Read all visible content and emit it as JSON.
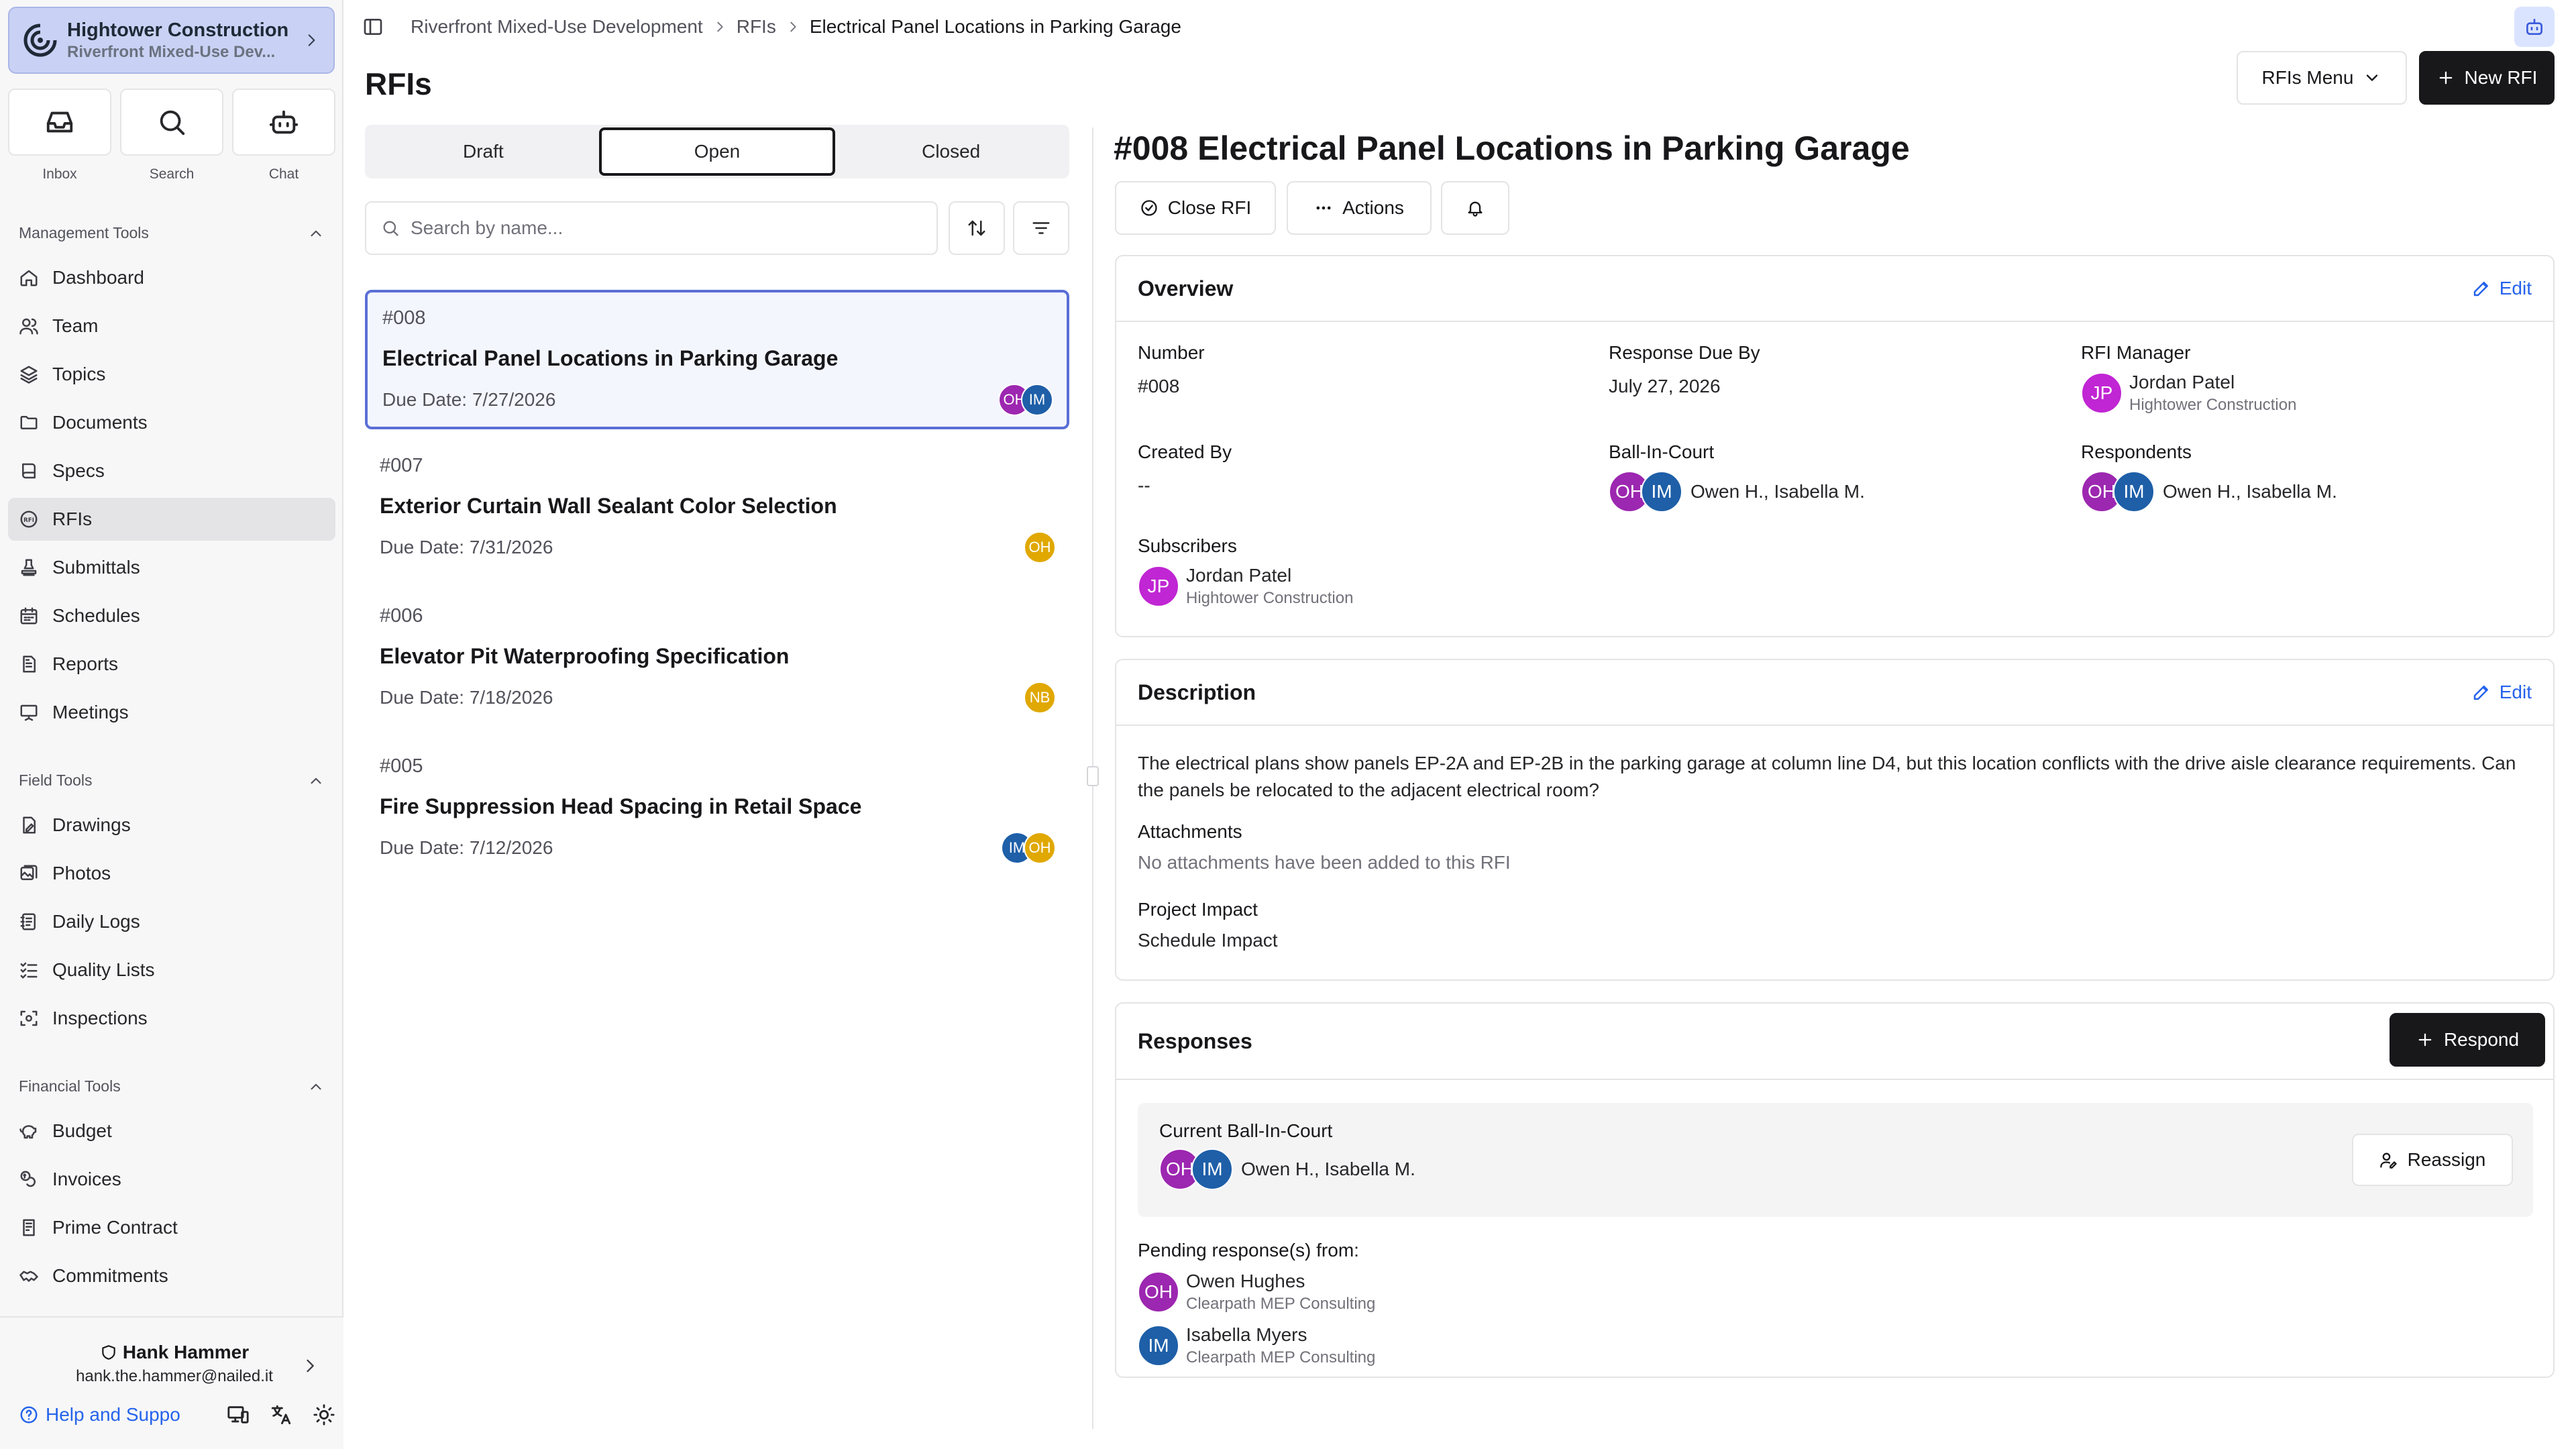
{
  "sidebar": {
    "project_name": "Hightower Construction",
    "project_sub": "Riverfront Mixed-Use Dev...",
    "quick": [
      {
        "label": "Inbox"
      },
      {
        "label": "Search"
      },
      {
        "label": "Chat"
      }
    ],
    "sections": {
      "management": "Management Tools",
      "field": "Field Tools",
      "financial": "Financial Tools"
    },
    "management_items": [
      "Dashboard",
      "Team",
      "Topics",
      "Documents",
      "Specs",
      "RFIs",
      "Submittals",
      "Schedules",
      "Reports",
      "Meetings"
    ],
    "field_items": [
      "Drawings",
      "Photos",
      "Daily Logs",
      "Quality Lists",
      "Inspections"
    ],
    "financial_items": [
      "Budget",
      "Invoices",
      "Prime Contract",
      "Commitments"
    ],
    "user": {
      "name": "Hank Hammer",
      "email": "hank.the.hammer@nailed.it"
    },
    "help_label": "Help and Suppo"
  },
  "breadcrumb": [
    "Riverfront Mixed-Use Development",
    "RFIs",
    "Electrical Panel Locations in Parking Garage"
  ],
  "page": {
    "title": "RFIs",
    "menu_label": "RFIs Menu",
    "new_label": "New RFI"
  },
  "list": {
    "tabs": [
      "Draft",
      "Open",
      "Closed"
    ],
    "active_tab": "Open",
    "search_placeholder": "Search by name...",
    "items": [
      {
        "number": "#008",
        "title": "Electrical Panel Locations in Parking Garage",
        "due": "Due Date: 7/27/2026",
        "avatars": [
          "OH",
          "IM"
        ]
      },
      {
        "number": "#007",
        "title": "Exterior Curtain Wall Sealant Color Selection",
        "due": "Due Date: 7/31/2026",
        "avatars": [
          "OH"
        ]
      },
      {
        "number": "#006",
        "title": "Elevator Pit Waterproofing Specification",
        "due": "Due Date: 7/18/2026",
        "avatars": [
          "NB"
        ]
      },
      {
        "number": "#005",
        "title": "Fire Suppression Head Spacing in Retail Space",
        "due": "Due Date: 7/12/2026",
        "avatars": [
          "IM",
          "OH"
        ]
      }
    ]
  },
  "detail": {
    "title": "#008 Electrical Panel Locations in Parking Garage",
    "close_label": "Close RFI",
    "actions_label": "Actions",
    "overview": {
      "title": "Overview",
      "edit": "Edit",
      "number_label": "Number",
      "number": "#008",
      "due_label": "Response Due By",
      "due": "July 27, 2026",
      "manager_label": "RFI Manager",
      "manager": {
        "initials": "JP",
        "name": "Jordan Patel",
        "org": "Hightower Construction"
      },
      "created_label": "Created By",
      "created": "--",
      "bic_label": "Ball-In-Court",
      "bic_names": "Owen H., Isabella M.",
      "respondents_label": "Respondents",
      "respondents_names": "Owen H., Isabella M.",
      "subscribers_label": "Subscribers",
      "subscriber": {
        "initials": "JP",
        "name": "Jordan Patel",
        "org": "Hightower Construction"
      }
    },
    "description": {
      "title": "Description",
      "edit": "Edit",
      "text": "The electrical plans show panels EP-2A and EP-2B in the parking garage at column line D4, but this location conflicts with the drive aisle clearance requirements. Can the panels be relocated to the adjacent electrical room?",
      "attachments_label": "Attachments",
      "attachments": "No attachments have been added to this RFI",
      "impact_label": "Project Impact",
      "impact": "Schedule Impact"
    },
    "responses": {
      "title": "Responses",
      "respond_label": "Respond",
      "current_bic_label": "Current Ball-In-Court",
      "current_bic_names": "Owen H., Isabella M.",
      "reassign_label": "Reassign",
      "pending_label": "Pending response(s) from:",
      "pending": [
        {
          "initials": "OH",
          "name": "Owen Hughes",
          "org": "Clearpath MEP Consulting"
        },
        {
          "initials": "IM",
          "name": "Isabella Myers",
          "org": "Clearpath MEP Consulting"
        }
      ]
    }
  },
  "avatar_initials": {
    "oh": "OH",
    "im": "IM",
    "nb": "NB"
  },
  "colors": {
    "oh": "#9c27b0",
    "im": "#1e5fa8",
    "jp": "#c026d3",
    "yellow": "#e0a800",
    "link": "#2563eb"
  }
}
